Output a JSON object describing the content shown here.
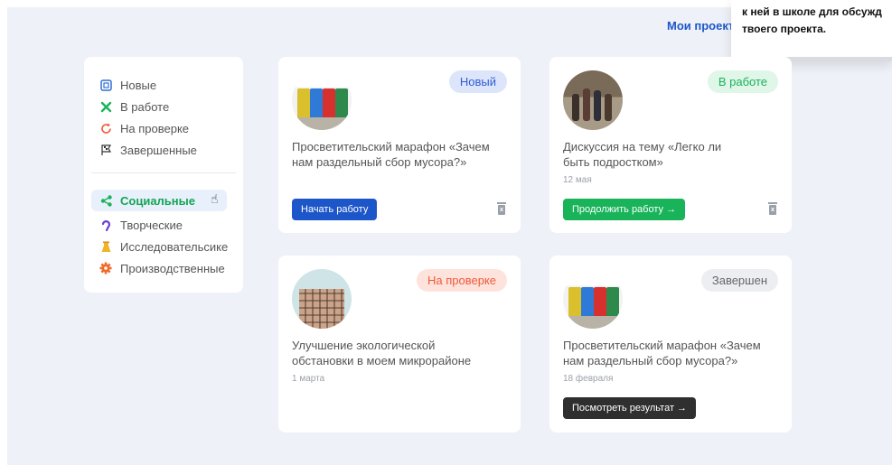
{
  "header": {
    "my_projects_link": "Мои проект"
  },
  "tooltip": {
    "line1": "к ней в школе для обсужд",
    "line2": "твоего проекта."
  },
  "sidebar": {
    "status_filters": [
      {
        "label": "Новые",
        "icon": "new-icon",
        "color": "#2f6fd6"
      },
      {
        "label": "В работе",
        "icon": "tools-icon",
        "color": "#19b35a"
      },
      {
        "label": "На проверке",
        "icon": "refresh-icon",
        "color": "#f05a3a"
      },
      {
        "label": "Завершенные",
        "icon": "flag-icon",
        "color": "#333333"
      }
    ],
    "category_filters": [
      {
        "label": "Социальные",
        "icon": "share-icon",
        "color": "#19b35a",
        "active": true
      },
      {
        "label": "Творческие",
        "icon": "ear-icon",
        "color": "#6a3fd6"
      },
      {
        "label": "Исследовательсике",
        "icon": "flask-icon",
        "color": "#f0b428"
      },
      {
        "label": "Производственные",
        "icon": "gear-icon",
        "color": "#f06a2a"
      }
    ]
  },
  "cards": [
    {
      "badge": "Новый",
      "badge_bg": "#dde5fb",
      "badge_color": "#2f5cd6",
      "title": "Просветительский марафон «Зачем нам раздельный сбор мусора?»",
      "date": "",
      "button": "Начать работу",
      "button_bg": "#1d56c9",
      "image": "recycling-bins-image",
      "show_trash": true
    },
    {
      "badge": "В работе",
      "badge_bg": "#dff6e8",
      "badge_color": "#19b35a",
      "title": "Дискуссия на тему «Легко ли быть подростком»",
      "date": "12 мая",
      "button": "Продолжить работу  →",
      "button_bg": "#19b35a",
      "image": "teenagers-image",
      "show_trash": true
    },
    {
      "badge": "На проверке",
      "badge_bg": "#fde3dc",
      "badge_color": "#f05a3a",
      "title": "Улучшение экологической обстановки в моем микрорайоне",
      "date": "1 марта",
      "button": "",
      "image": "building-image",
      "show_trash": false
    },
    {
      "badge": "Завершен",
      "badge_bg": "#eceef2",
      "badge_color": "#666666",
      "title": "Просветительский марафон «Зачем нам раздельный сбор мусора?»",
      "date": "18 февраля",
      "button": "Посмотреть результат  →",
      "button_bg": "#2f2f2f",
      "image": "recycling-bins-image",
      "show_trash": false
    }
  ]
}
